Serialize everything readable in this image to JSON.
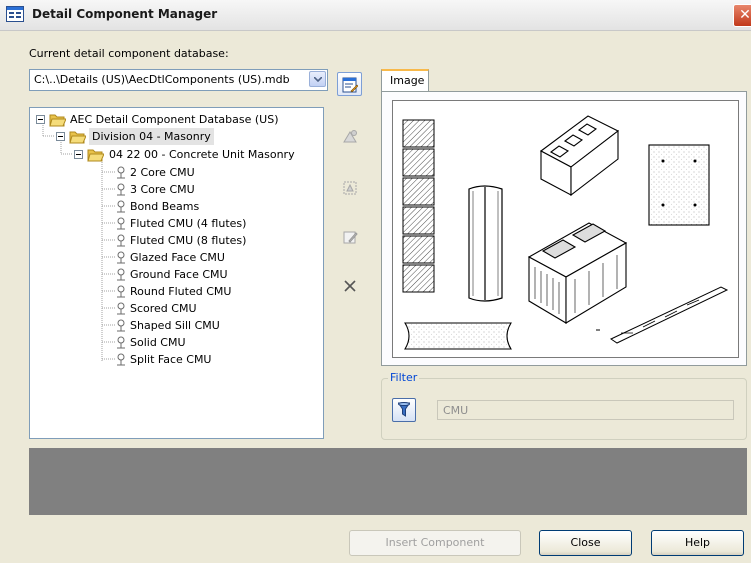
{
  "window": {
    "title": "Detail Component Manager"
  },
  "database": {
    "label": "Current detail component database:",
    "path": "C:\\..\\Details (US)\\AecDtlComponents (US).mdb"
  },
  "tree": {
    "root": "AEC Detail Component Database (US)",
    "division": "Division 04 - Masonry",
    "section": "04 22 00 - Concrete Unit Masonry",
    "items": [
      "2 Core CMU",
      "3 Core CMU",
      "Bond Beams",
      "Fluted CMU (4 flutes)",
      "Fluted CMU (8 flutes)",
      "Glazed Face CMU",
      "Ground Face CMU",
      "Round Fluted CMU",
      "Scored CMU",
      "Shaped Sill CMU",
      "Solid CMU",
      "Split Face CMU"
    ]
  },
  "tabs": {
    "image": "Image"
  },
  "filter": {
    "legend": "Filter",
    "value": "CMU"
  },
  "buttons": {
    "insert": "Insert Component",
    "close": "Close",
    "help": "Help"
  },
  "colors": {
    "accent": "#0046d5",
    "folder": "#e8c24a",
    "description_bg": "#808080"
  }
}
